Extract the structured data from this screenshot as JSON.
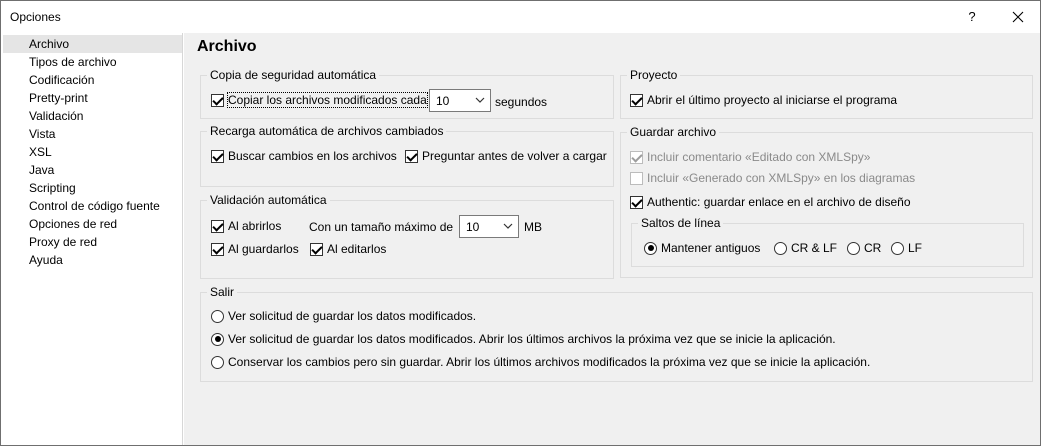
{
  "window": {
    "title": "Opciones",
    "help_glyph": "?",
    "close_glyph": "✕"
  },
  "sidebar": {
    "items": [
      {
        "label": "Archivo",
        "selected": true
      },
      {
        "label": "Tipos de archivo"
      },
      {
        "label": "Codificación"
      },
      {
        "label": "Pretty-print"
      },
      {
        "label": "Validación"
      },
      {
        "label": "Vista"
      },
      {
        "label": "XSL"
      },
      {
        "label": "Java"
      },
      {
        "label": "Scripting"
      },
      {
        "label": "Control de código fuente"
      },
      {
        "label": "Opciones de red"
      },
      {
        "label": "Proxy de red"
      },
      {
        "label": "Ayuda"
      }
    ]
  },
  "main": {
    "heading": "Archivo",
    "backup": {
      "legend": "Copia de seguridad automática",
      "copy_label": "Copiar los archivos modificados cada",
      "copy_checked": true,
      "interval_value": "10",
      "unit": "segundos"
    },
    "reload": {
      "legend": "Recarga automática de archivos cambiados",
      "search_label": "Buscar cambios en los archivos",
      "search_checked": true,
      "ask_label": "Preguntar antes de volver a cargar",
      "ask_checked": true
    },
    "validation": {
      "legend": "Validación automática",
      "on_open_label": "Al abrirlos",
      "on_open_checked": true,
      "max_size_label": "Con un tamaño máximo de",
      "max_size_value": "10",
      "max_size_unit": "MB",
      "on_save_label": "Al guardarlos",
      "on_save_checked": true,
      "on_edit_label": "Al editarlos",
      "on_edit_checked": true
    },
    "project": {
      "legend": "Proyecto",
      "open_last_label": "Abrir el último proyecto al iniciarse el programa",
      "open_last_checked": true
    },
    "save": {
      "legend": "Guardar archivo",
      "comment_label": "Incluir comentario «Editado con XMLSpy»",
      "generated_label": "Incluir «Generado con XMLSpy» en los diagramas",
      "authentic_label": "Authentic: guardar enlace en el archivo de diseño",
      "authentic_checked": true,
      "line_breaks": {
        "legend": "Saltos de línea",
        "options": [
          "Mantener antiguos",
          "CR & LF",
          "CR",
          "LF"
        ],
        "selected": "Mantener antiguos"
      }
    },
    "exit": {
      "legend": "Salir",
      "options": [
        "Ver solicitud de guardar los datos modificados.",
        "Ver solicitud de guardar los datos modificados. Abrir los últimos archivos la próxima vez que se inicie la aplicación.",
        "Conservar los cambios pero sin guardar. Abrir los últimos archivos modificados la próxima vez que se inicie la aplicación."
      ],
      "selected_index": 1
    }
  }
}
